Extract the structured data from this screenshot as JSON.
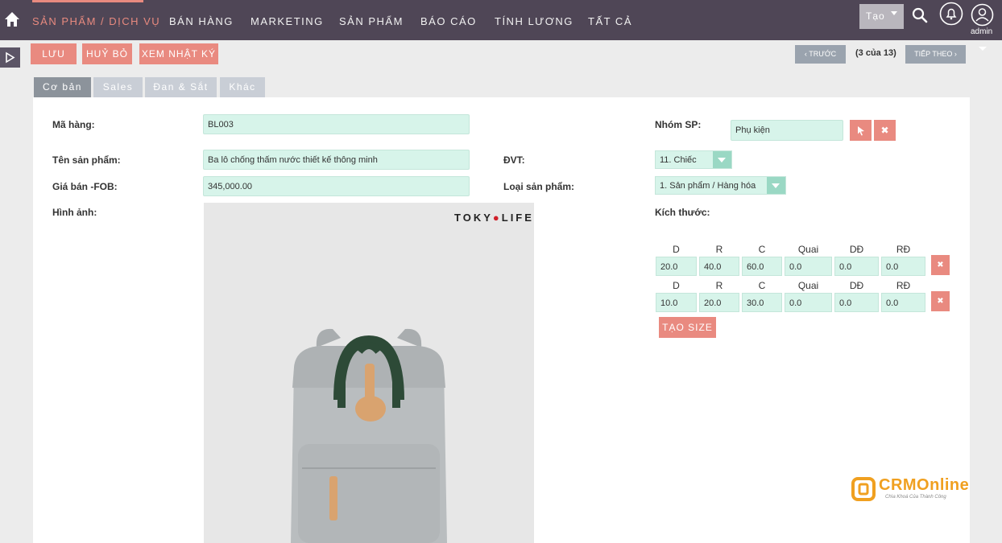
{
  "nav": {
    "items": [
      "SẢN PHẨM / DỊCH VỤ",
      "BÁN HÀNG",
      "MARKETING",
      "SẢN PHẨM",
      "BÁO CÁO",
      "TÍNH LƯƠNG",
      "TẤT CẢ"
    ],
    "create_label": "Tạo",
    "user_label": "admin"
  },
  "actions": {
    "save": "LƯU",
    "cancel": "HUỶ BỎ",
    "log": "XEM NHẬT KÝ",
    "prev": "TRƯỚC",
    "next": "TIẾP THEO",
    "pager": "(3 của 13)"
  },
  "tabs": [
    "Cơ bản",
    "Sales",
    "Đan & Sắt",
    "Khác"
  ],
  "form": {
    "code_label": "Mã hàng:",
    "code_value": "BL003",
    "name_label": "Tên sản phẩm:",
    "name_value": "Ba lô chống thấm nước thiết kế thông minh",
    "price_label": "Giá bán -FOB:",
    "price_value": "345,000.00",
    "image_label": "Hình ảnh:",
    "group_label": "Nhóm SP:",
    "group_value": "Phụ kiện",
    "unit_label": "ĐVT:",
    "unit_value": "11. Chiếc",
    "type_label": "Loại sản phẩm:",
    "type_value": "1. Sản phẩm / Hàng hóa",
    "size_label": "Kích thước:"
  },
  "sizes": {
    "headers": [
      "D",
      "R",
      "C",
      "Quai",
      "DĐ",
      "RĐ"
    ],
    "rows": [
      [
        "20.0",
        "40.0",
        "60.0",
        "0.0",
        "0.0",
        "0.0"
      ],
      [
        "10.0",
        "20.0",
        "30.0",
        "0.0",
        "0.0",
        "0.0"
      ]
    ],
    "add_label": "TẠO SIZE"
  },
  "image": {
    "brand": "TOKY●LIFE"
  },
  "logo": {
    "name": "CRMOnline",
    "slogan": "Chìa Khoá Của Thành Công"
  },
  "colors": {
    "nav_bg": "#4f4656",
    "accent": "#e98a80",
    "field_bg": "#d7f4ea"
  }
}
